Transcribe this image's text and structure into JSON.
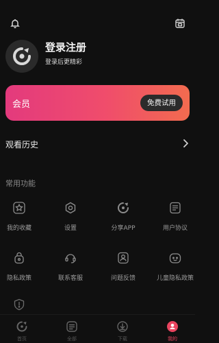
{
  "header": {
    "left_icon": "bell-icon",
    "right_icon": "calendar-icon"
  },
  "profile": {
    "avatar_icon": "avatar-placeholder-icon",
    "title": "登录注册",
    "subtitle": "登录后更精彩"
  },
  "vip": {
    "label": "会员",
    "button": "免费试用",
    "accent_start": "#e33a7d",
    "accent_end": "#f26b4f"
  },
  "history": {
    "label": "观看历史",
    "icon": "chevron-right-icon"
  },
  "functions": {
    "title": "常用功能",
    "items": [
      {
        "label": "我的收藏",
        "icon": "star-icon"
      },
      {
        "label": "设置",
        "icon": "gear-icon"
      },
      {
        "label": "分享APP",
        "icon": "share-icon"
      },
      {
        "label": "用户协议",
        "icon": "document-icon"
      },
      {
        "label": "隐私政策",
        "icon": "privacy-icon"
      },
      {
        "label": "联系客服",
        "icon": "customer-service-icon"
      },
      {
        "label": "问题反馈",
        "icon": "feedback-icon"
      },
      {
        "label": "儿童隐私政策",
        "icon": "child-privacy-icon"
      },
      {
        "label": "",
        "icon": "shield-alert-icon"
      }
    ]
  },
  "tabbar": {
    "active_color": "#e8445f",
    "items": [
      {
        "label": "首页",
        "icon": "home-icon"
      },
      {
        "label": "全部",
        "icon": "all-icon"
      },
      {
        "label": "下载",
        "icon": "download-icon"
      },
      {
        "label": "我的",
        "icon": "profile-icon"
      }
    ]
  }
}
